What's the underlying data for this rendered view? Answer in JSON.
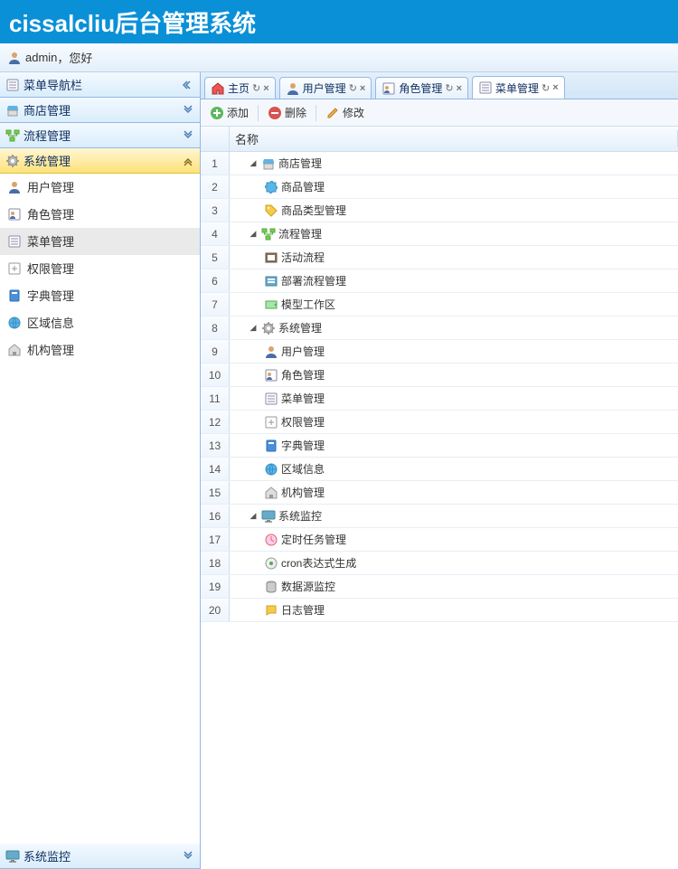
{
  "header": {
    "title": "cissalcliu后台管理系统"
  },
  "userbar": {
    "username": "admin",
    "greeting": "，您好"
  },
  "sidebar": {
    "nav_header": "菜单导航栏",
    "panels": [
      {
        "label": "商店管理",
        "icon": "store"
      },
      {
        "label": "流程管理",
        "icon": "flow"
      },
      {
        "label": "系统管理",
        "icon": "gear",
        "expanded": true
      },
      {
        "label": "系统监控",
        "icon": "monitor"
      }
    ],
    "system_items": [
      {
        "label": "用户管理",
        "icon": "user"
      },
      {
        "label": "角色管理",
        "icon": "role"
      },
      {
        "label": "菜单管理",
        "icon": "menu",
        "selected": true
      },
      {
        "label": "权限管理",
        "icon": "perm"
      },
      {
        "label": "字典管理",
        "icon": "dict"
      },
      {
        "label": "区域信息",
        "icon": "globe"
      },
      {
        "label": "机构管理",
        "icon": "org"
      }
    ]
  },
  "tabs": [
    {
      "label": "主页",
      "icon": "home"
    },
    {
      "label": "用户管理",
      "icon": "user"
    },
    {
      "label": "角色管理",
      "icon": "role"
    },
    {
      "label": "菜单管理",
      "icon": "menu",
      "active": true
    }
  ],
  "toolbar": {
    "add": "添加",
    "delete": "删除",
    "edit": "修改"
  },
  "grid": {
    "header_name": "名称",
    "rows": [
      {
        "n": 1,
        "level": 0,
        "expander": true,
        "icon": "store",
        "label": "商店管理"
      },
      {
        "n": 2,
        "level": 1,
        "expander": false,
        "icon": "puzzle",
        "label": "商品管理"
      },
      {
        "n": 3,
        "level": 1,
        "expander": false,
        "icon": "tag",
        "label": "商品类型管理"
      },
      {
        "n": 4,
        "level": 0,
        "expander": true,
        "icon": "flow",
        "label": "流程管理"
      },
      {
        "n": 5,
        "level": 1,
        "expander": false,
        "icon": "act",
        "label": "活动流程"
      },
      {
        "n": 6,
        "level": 1,
        "expander": false,
        "icon": "deploy",
        "label": "部署流程管理"
      },
      {
        "n": 7,
        "level": 1,
        "expander": false,
        "icon": "model",
        "label": "模型工作区"
      },
      {
        "n": 8,
        "level": 0,
        "expander": true,
        "icon": "gear",
        "label": "系统管理"
      },
      {
        "n": 9,
        "level": 1,
        "expander": false,
        "icon": "user",
        "label": "用户管理"
      },
      {
        "n": 10,
        "level": 1,
        "expander": false,
        "icon": "role",
        "label": "角色管理"
      },
      {
        "n": 11,
        "level": 1,
        "expander": false,
        "icon": "menu",
        "label": "菜单管理"
      },
      {
        "n": 12,
        "level": 1,
        "expander": false,
        "icon": "perm",
        "label": "权限管理"
      },
      {
        "n": 13,
        "level": 1,
        "expander": false,
        "icon": "dict",
        "label": "字典管理"
      },
      {
        "n": 14,
        "level": 1,
        "expander": false,
        "icon": "globe",
        "label": "区域信息"
      },
      {
        "n": 15,
        "level": 1,
        "expander": false,
        "icon": "org",
        "label": "机构管理"
      },
      {
        "n": 16,
        "level": 0,
        "expander": true,
        "icon": "monitor",
        "label": "系统监控"
      },
      {
        "n": 17,
        "level": 1,
        "expander": false,
        "icon": "clock",
        "label": "定时任务管理"
      },
      {
        "n": 18,
        "level": 1,
        "expander": false,
        "icon": "cron",
        "label": "cron表达式生成"
      },
      {
        "n": 19,
        "level": 1,
        "expander": false,
        "icon": "db",
        "label": "数据源监控"
      },
      {
        "n": 20,
        "level": 1,
        "expander": false,
        "icon": "log",
        "label": "日志管理"
      }
    ]
  }
}
